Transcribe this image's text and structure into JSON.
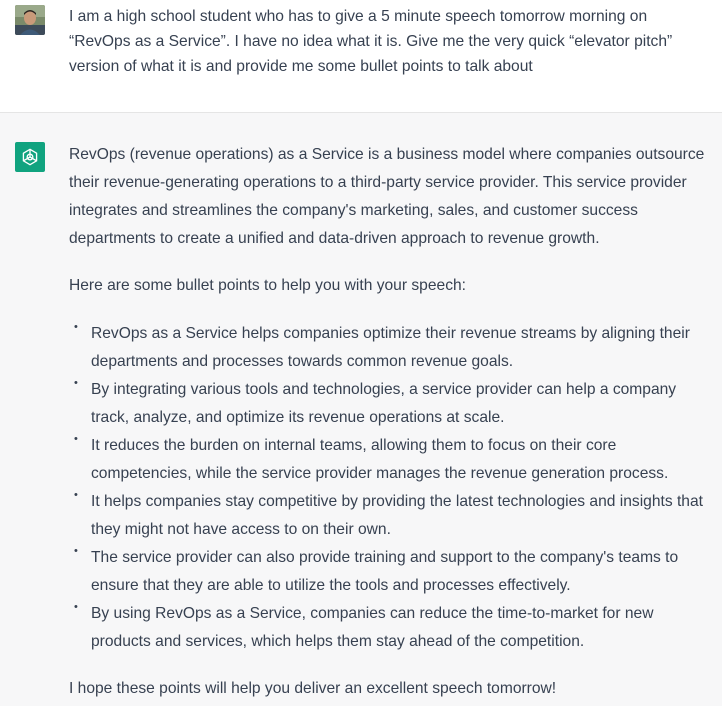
{
  "user_message": {
    "avatar": "user-avatar-photo",
    "text": "I am a high school student who has to give a 5 minute speech tomorrow morning on “RevOps as a Service”.  I have no idea what it is.  Give me the very quick “elevator pitch” version of what it is and provide me some bullet points to talk about"
  },
  "assistant_message": {
    "avatar_icon": "openai-logo-icon",
    "accent_color": "#10a37f",
    "intro": "RevOps (revenue operations) as a Service is a business model where companies outsource their revenue-generating operations to a third-party service provider. This service provider integrates and streamlines the company's marketing, sales, and customer success departments to create a unified and data-driven approach to revenue growth.",
    "lead": "Here are some bullet points to help you with your speech:",
    "bullets": [
      "RevOps as a Service helps companies optimize their revenue streams by aligning their departments and processes towards common revenue goals.",
      "By integrating various tools and technologies, a service provider can help a company track, analyze, and optimize its revenue operations at scale.",
      "It reduces the burden on internal teams, allowing them to focus on their core competencies, while the service provider manages the revenue generation process.",
      "It helps companies stay competitive by providing the latest technologies and insights that they might not have access to on their own.",
      "The service provider can also provide training and support to the company's teams to ensure that they are able to utilize the tools and processes effectively.",
      "By using RevOps as a Service, companies can reduce the time-to-market for new products and services, which helps them stay ahead of the competition."
    ],
    "closing": "I hope these points will help you deliver an excellent speech tomorrow!"
  }
}
